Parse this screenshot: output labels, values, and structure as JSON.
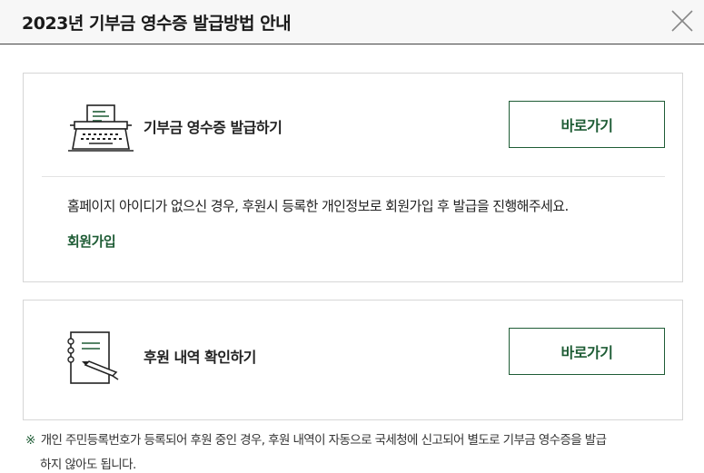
{
  "modal": {
    "title": "2023년 기부금 영수증 발급방법 안내",
    "close_icon": "close-icon"
  },
  "cards": [
    {
      "icon": "typewriter-icon",
      "label": "기부금 영수증 발급하기",
      "button_label": "바로가기",
      "info_text": "홈페이지 아이디가 없으신 경우, 후원시 등록한 개인정보로 회원가입 후 발급을 진행해주세요.",
      "link_label": "회원가입"
    },
    {
      "icon": "notebook-pen-icon",
      "label": "후원 내역 확인하기",
      "button_label": "바로가기"
    }
  ],
  "notice": {
    "mark": "※",
    "line1": "개인 주민등록번호가 등록되어 후원 중인 경우, 후원 내역이 자동으로 국세청에 신고되어 별도로 기부금 영수증을 발급",
    "line2": "하지 않아도 됩니다."
  },
  "colors": {
    "accent_green": "#1e5c35",
    "header_bg": "#f7f7f7",
    "card_border": "#d6d6d6"
  }
}
